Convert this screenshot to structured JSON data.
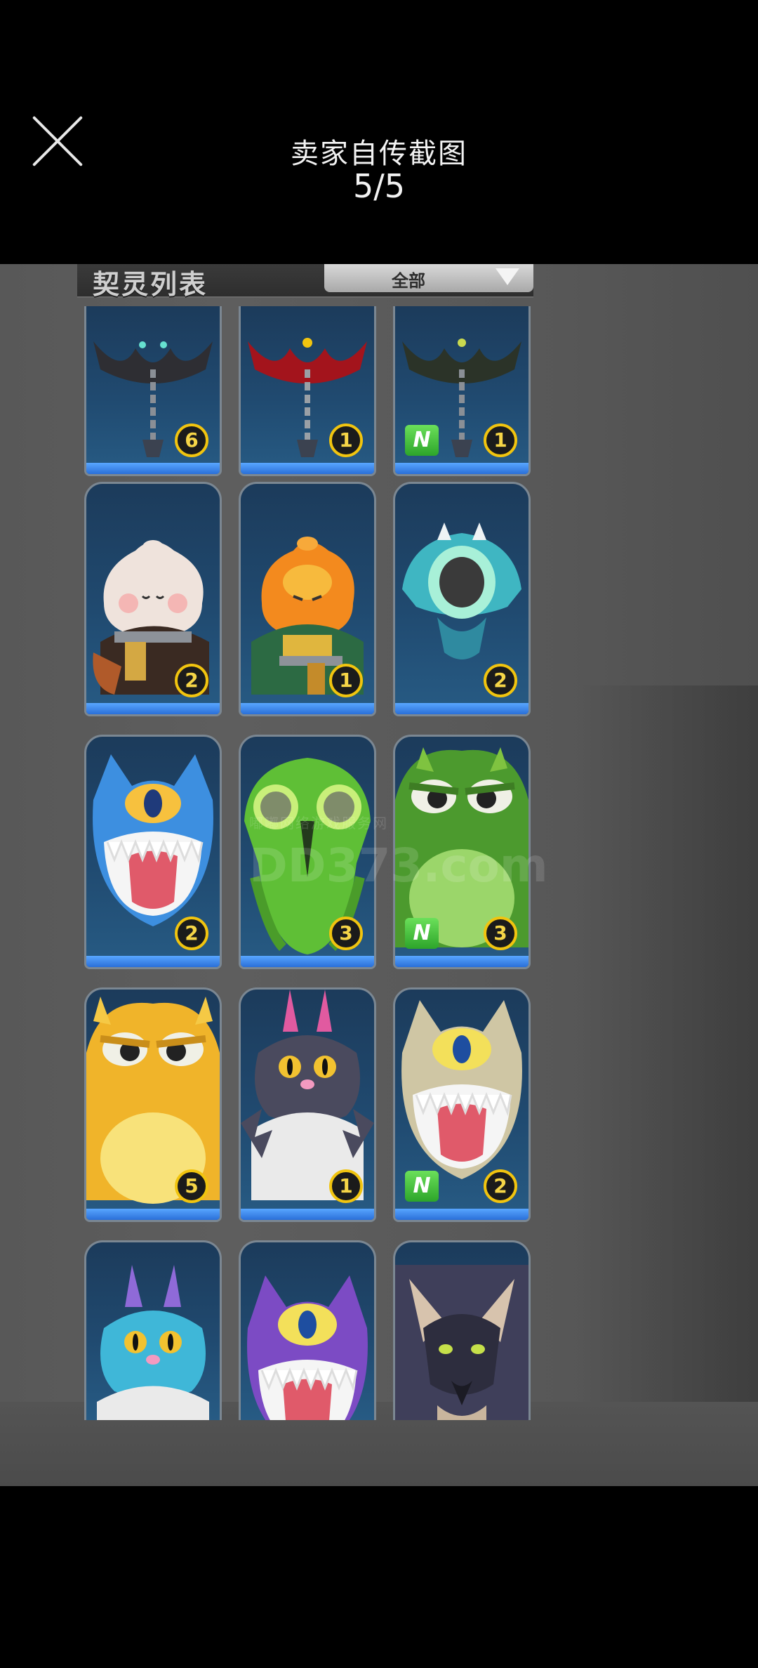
{
  "viewer": {
    "title": "卖家自传截图",
    "counter": "5/5"
  },
  "game": {
    "list_title": "契灵列表",
    "filter_label": "全部",
    "watermark_line1": "嘟嘟网络游戏服务网",
    "watermark_line2": "DD373.com"
  },
  "cards": [
    {
      "count": "6",
      "new": false,
      "creature": "dark-bat-on-chain"
    },
    {
      "count": "1",
      "new": false,
      "creature": "red-bat-on-chain"
    },
    {
      "count": "1",
      "new": true,
      "new_label": "N",
      "creature": "black-bat-on-chain"
    },
    {
      "count": "2",
      "new": false,
      "creature": "white-bun-swordsman"
    },
    {
      "count": "1",
      "new": false,
      "creature": "orange-bun-swordsman"
    },
    {
      "count": "2",
      "new": false,
      "creature": "teal-one-eyed-ghost"
    },
    {
      "count": "2",
      "new": false,
      "creature": "blue-cyclops-cat"
    },
    {
      "count": "3",
      "new": false,
      "creature": "green-squid-alien"
    },
    {
      "count": "3",
      "new": true,
      "new_label": "N",
      "creature": "green-frog-beast"
    },
    {
      "count": "5",
      "new": false,
      "creature": "yellow-frog-beast"
    },
    {
      "count": "1",
      "new": false,
      "creature": "gray-rabbit-cat"
    },
    {
      "count": "2",
      "new": true,
      "new_label": "N",
      "creature": "beige-cyclops-cat"
    },
    {
      "count": "",
      "new": false,
      "creature": "cyan-rabbit-cat"
    },
    {
      "count": "",
      "new": false,
      "creature": "purple-cyclops-cat"
    },
    {
      "count": "",
      "new": false,
      "creature": "dark-wolf-bat"
    }
  ]
}
